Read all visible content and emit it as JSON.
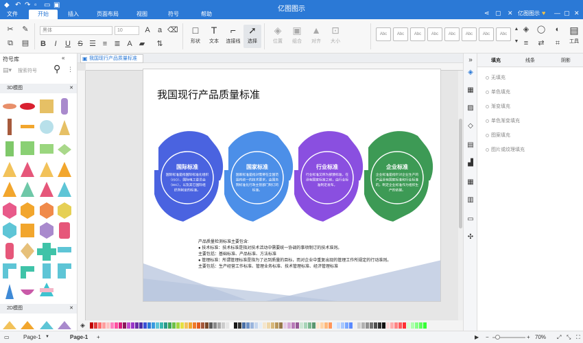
{
  "app": {
    "title": "亿图图示",
    "account": "亿图图示"
  },
  "menu": {
    "file": "文件",
    "tabs": [
      "开始",
      "插入",
      "页面布局",
      "视图",
      "符号",
      "帮助"
    ]
  },
  "ribbon": {
    "font_family": "黑体",
    "font_size": "10",
    "tools": [
      {
        "label": "形状",
        "icon": "shape-icon"
      },
      {
        "label": "文本",
        "icon": "text-icon"
      },
      {
        "label": "连接线",
        "icon": "connector-icon"
      },
      {
        "label": "选择",
        "icon": "select-icon"
      }
    ],
    "disabled_tools": [
      "位置",
      "组合",
      "对齐",
      "大小"
    ],
    "style_sample": "Abc",
    "tools_label": "工具"
  },
  "left_panel": {
    "title": "符号库",
    "search_placeholder": "搜索符号",
    "categories": [
      "3D模图",
      "2D模图"
    ]
  },
  "document": {
    "tab_name": "我国现行产品质量标准"
  },
  "diagram": {
    "title": "我国现行产品质量标准",
    "cards": [
      {
        "title": "国际标准",
        "body": "国际标准是指国际标准化组织（ISO）、国际电工委员会（IEC），以及其它国际组织所制定的标准。",
        "color": "#4a63e0"
      },
      {
        "title": "国家标准",
        "body": "国家标准是指对需要在全国范围内统一的技术要求，由国务院标准化行政主管部门制订的标准。",
        "color": "#4c8fe8"
      },
      {
        "title": "行业标准",
        "body": "行业标准又称为部颁标准，在没有国家标准之前，由行业标准制定发布。",
        "color": "#8a4fe0"
      },
      {
        "title": "企业标准",
        "body": "企业标准是指针对企业生产的产品没有国家标准和行业标准的，制定企业标准作为组织生产的依据。",
        "color": "#3d9a55"
      }
    ],
    "notes": [
      "产品质量检测标准主要包含:",
      "● 技术标准：技术标准是指对技术活动中需要统一协调的事项制订的技术准则。",
      "主要包括：基础标准、产品标准、方法标准",
      "● 管理标准：所谓管理标准是指为了达到质量的目标，而对企业中重复出现的管理工作所规定的行动准则。",
      "主要包括：生产经营工作标准、管理业务标准、技术管理标准、经济管理标准"
    ]
  },
  "right_panel": {
    "tabs": [
      "填充",
      "线条",
      "阴影"
    ],
    "options": [
      "无填充",
      "单色填充",
      "渐变填充",
      "单色渐变填充",
      "图案填充",
      "图片或纹理填充"
    ]
  },
  "status": {
    "page_selector": "Page-1",
    "active_page": "Page-1",
    "add_page": "+",
    "zoom": "70%"
  }
}
